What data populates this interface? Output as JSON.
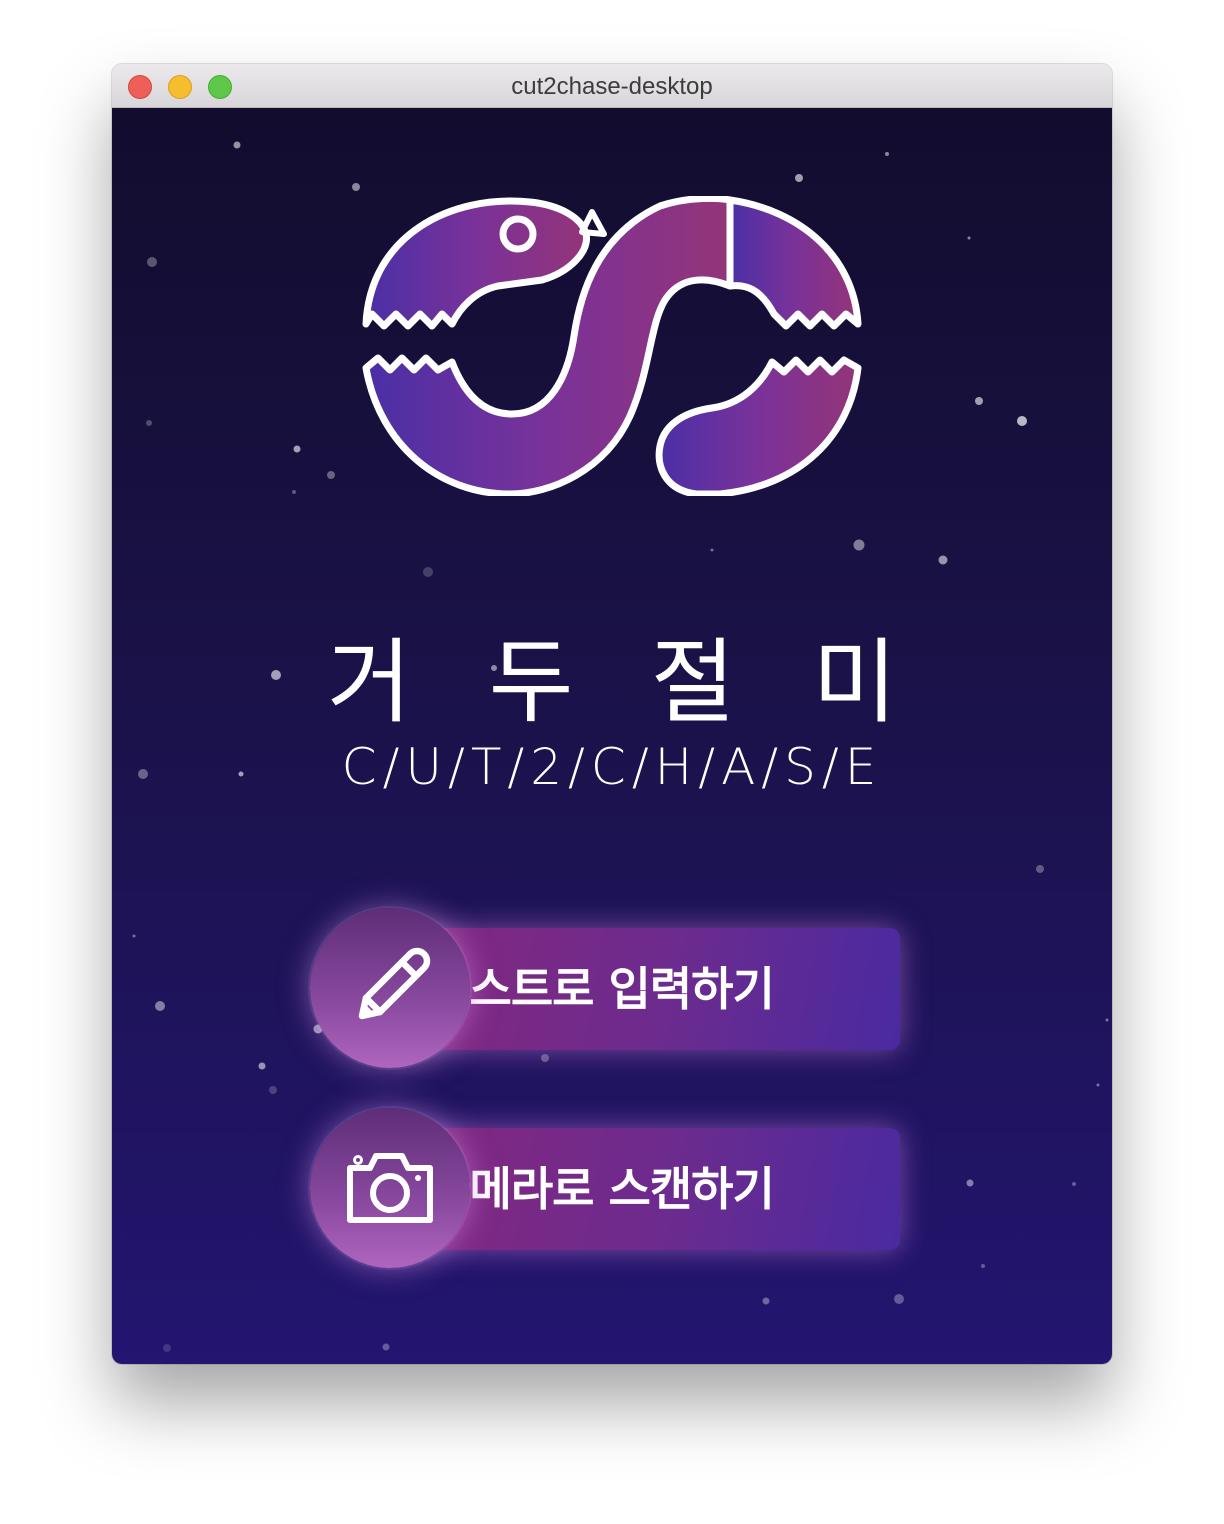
{
  "window": {
    "title": "cut2chase-desktop"
  },
  "app": {
    "name": "거 두 절 미",
    "subtitle": "C/U/T/2/C/H/A/S/E"
  },
  "actions": [
    {
      "label": "텍스트로 입력하기",
      "icon": "pencil-icon"
    },
    {
      "label": "카메라로 스캔하기",
      "icon": "camera-icon"
    }
  ],
  "colors": {
    "background_top": "#120d2e",
    "background_bottom": "#231570",
    "logo_gradient_start": "#4a2fa6",
    "logo_gradient_end": "#943478",
    "button_gradient_start": "#85277e",
    "button_gradient_end": "#4a2aa0"
  }
}
